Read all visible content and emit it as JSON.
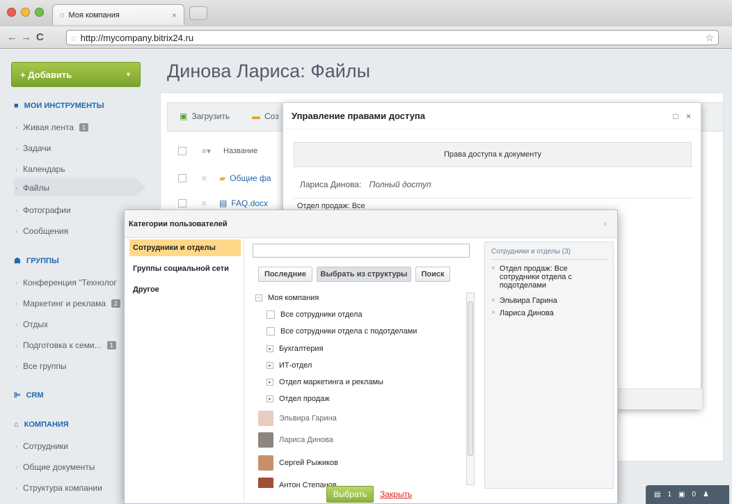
{
  "browser": {
    "tab_title": "Моя компания",
    "tab_close": "×",
    "url": "http://mycompany.bitrix24.ru",
    "star": "☆"
  },
  "header": {
    "add_button": "+ Добавить",
    "page_title": "Динова Лариса: Файлы"
  },
  "sidebar": {
    "sections": [
      {
        "title": "МОИ ИНСТРУМЕНТЫ",
        "items": [
          "Живая лента",
          "Задачи",
          "Календарь",
          "Файлы",
          "Фотографии",
          "Сообщения"
        ]
      },
      {
        "title": "ГРУППЫ",
        "items": [
          "Конференция \"Технолог",
          "Маркетинг и реклама",
          "Отдых",
          "Подготовка к семи...",
          "Все группы"
        ]
      },
      {
        "title": "CRM",
        "items": []
      },
      {
        "title": "КОМПАНИЯ",
        "items": [
          "Сотрудники",
          "Общие документы",
          "Структура компании"
        ]
      }
    ],
    "badge_live": "1",
    "badge_marketing": "2",
    "badge_seminar": "1"
  },
  "toolbar": {
    "upload": "Загрузить",
    "create": "Соз",
    "col_name": "Название",
    "files": [
      "Общие фа",
      "FAQ.docx"
    ]
  },
  "access_dialog": {
    "title": "Управление правами доступа",
    "controls": "□ ×",
    "section": "Права доступа к документу",
    "user": "Лариса Динова:",
    "user_right": "Полный доступ",
    "dept": "Отдел продаж: Все"
  },
  "categories_dialog": {
    "title": "Категории пользователей",
    "close": "×",
    "categories": [
      "Сотрудники и отделы",
      "Группы социальной сети",
      "Другое"
    ],
    "tabs": [
      "Последние",
      "Выбрать из структуры",
      "Поиск"
    ],
    "tree": {
      "root": "Моя компания",
      "options": [
        "Все сотрудники отдела",
        "Все сотрудники отдела с подотделами"
      ],
      "departments": [
        "Бухгалтерия",
        "ИТ-отдел",
        "Отдел маркетинга и рекламы",
        "Отдел продаж"
      ],
      "people": [
        "Эльвира Гарина",
        "Лариса Динова",
        "Сергей Рыжиков",
        "Антон Степанов"
      ]
    },
    "selected_header": "Сотрудники и отделы (3)",
    "selected": [
      "Отдел продаж: Все сотрудники отдела с подотделами",
      "Эльвира Гарина",
      "Лариса Динова"
    ],
    "ok": "Выбрать",
    "cancel": "Закрыть"
  },
  "bottom_bar": {
    "chat": "1",
    "notify": "0"
  }
}
